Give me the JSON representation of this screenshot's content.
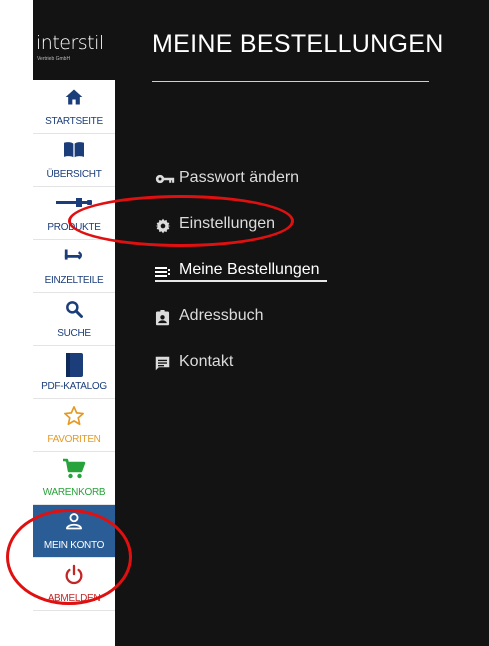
{
  "app": {
    "logo_text": "interstil",
    "logo_subtitle": "Vertrieb GmbH"
  },
  "header": {
    "title": "MEINE BESTELLUNGEN"
  },
  "sidebar": {
    "items": [
      {
        "label": "STARTSEITE",
        "icon": "home-icon"
      },
      {
        "label": "ÜBERSICHT",
        "icon": "book-open-icon"
      },
      {
        "label": "PRODUKTE",
        "icon": "product-icon"
      },
      {
        "label": "EINZELTEILE",
        "icon": "part-icon"
      },
      {
        "label": "SUCHE",
        "icon": "search-icon"
      },
      {
        "label": "PDF-KATALOG",
        "icon": "catalog-icon"
      },
      {
        "label": "FAVORITEN",
        "icon": "star-icon"
      },
      {
        "label": "WARENKORB",
        "icon": "cart-icon"
      },
      {
        "label": "MEIN KONTO",
        "icon": "user-icon",
        "active": true
      },
      {
        "label": "ABMELDEN",
        "icon": "power-icon"
      }
    ]
  },
  "account_menu": {
    "items": [
      {
        "label": "Passwort ändern",
        "icon": "key-icon"
      },
      {
        "label": "Einstellungen",
        "icon": "gear-icon"
      },
      {
        "label": "Meine Bestellungen",
        "icon": "list-icon",
        "active": true
      },
      {
        "label": "Adressbuch",
        "icon": "contact-card-icon"
      },
      {
        "label": "Kontakt",
        "icon": "message-icon"
      }
    ]
  },
  "colors": {
    "background": "#131313",
    "sidebar_active": "#2a5d95",
    "nav_label": "#1b3d7a",
    "favorites": "#e59a26",
    "cart": "#28a23a",
    "logout": "#c42626",
    "highlight_ring": "#e01010"
  }
}
